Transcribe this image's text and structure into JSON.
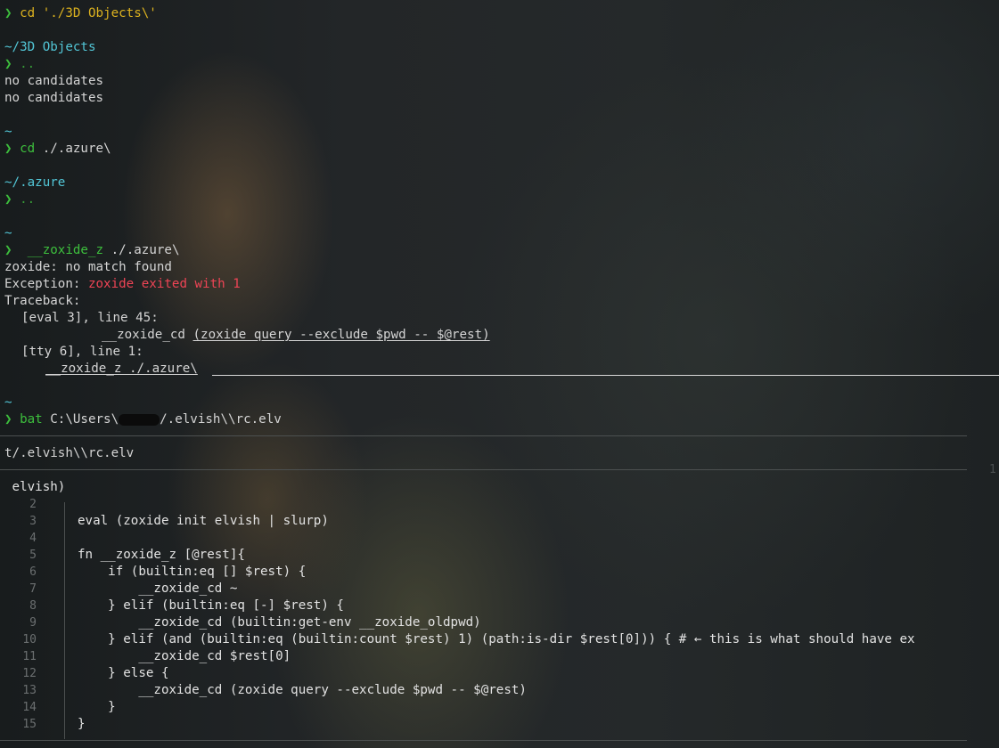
{
  "prompt_symbol": "❯",
  "history": {
    "cmd1": "cd './3D Objects\\'",
    "dir1": "~/3D Objects",
    "dotdot1": "..",
    "no_candidates_1": "no candidates",
    "no_candidates_2": "no candidates",
    "tilde1": "~",
    "cmd2": "cd ./.azure\\",
    "dir2": "~/.azure",
    "dotdot2": "..",
    "tilde2": "~",
    "cmd3_fn": "__zoxide_z",
    "cmd3_arg": "./.azure\\",
    "zoxide_msg": "zoxide: no match found",
    "exception_label": "Exception:",
    "exception_msg": "zoxide exited with 1",
    "traceback_label": "Traceback:",
    "tb1_loc": "[eval 3], line 45:",
    "tb1_fn": "__zoxide_cd",
    "tb1_expr": "(zoxide query --exclude $pwd -- $@rest)",
    "tb2_loc": "[tty 6], line 1:",
    "tb2_expr": "__zoxide_z ./.azure\\",
    "tilde3": "~",
    "cmd4_bin": "bat",
    "cmd4_path_a": "C:\\Users\\",
    "cmd4_path_b": "/.elvish\\\\rc.elv"
  },
  "bat": {
    "header_file": "t/.elvish\\\\rc.elv",
    "right_marker": "1",
    "line1_fragment": " elvish)",
    "lines": [
      {
        "num": "2",
        "text": ""
      },
      {
        "num": "3",
        "text": "eval (zoxide init elvish | slurp)"
      },
      {
        "num": "4",
        "text": ""
      },
      {
        "num": "5",
        "text": "fn __zoxide_z [@rest]{"
      },
      {
        "num": "6",
        "text": "    if (builtin:eq [] $rest) {"
      },
      {
        "num": "7",
        "text": "        __zoxide_cd ~"
      },
      {
        "num": "8",
        "text": "    } elif (builtin:eq [-] $rest) {"
      },
      {
        "num": "9",
        "text": "        __zoxide_cd (builtin:get-env __zoxide_oldpwd)"
      },
      {
        "num": "10",
        "text": "    } elif (and (builtin:eq (builtin:count $rest) 1) (path:is-dir $rest[0])) { # ← this is what should have ex"
      },
      {
        "num": "11",
        "text": "        __zoxide_cd $rest[0]"
      },
      {
        "num": "12",
        "text": "    } else {"
      },
      {
        "num": "13",
        "text": "        __zoxide_cd (zoxide query --exclude $pwd -- $@rest)"
      },
      {
        "num": "14",
        "text": "    }"
      },
      {
        "num": "15",
        "text": "}"
      }
    ]
  },
  "colors": {
    "prompt": "#3dbf3d",
    "string_arg": "#dcb21f",
    "directory": "#52c6d6",
    "error": "#ee4455",
    "background": "#1d2122"
  }
}
